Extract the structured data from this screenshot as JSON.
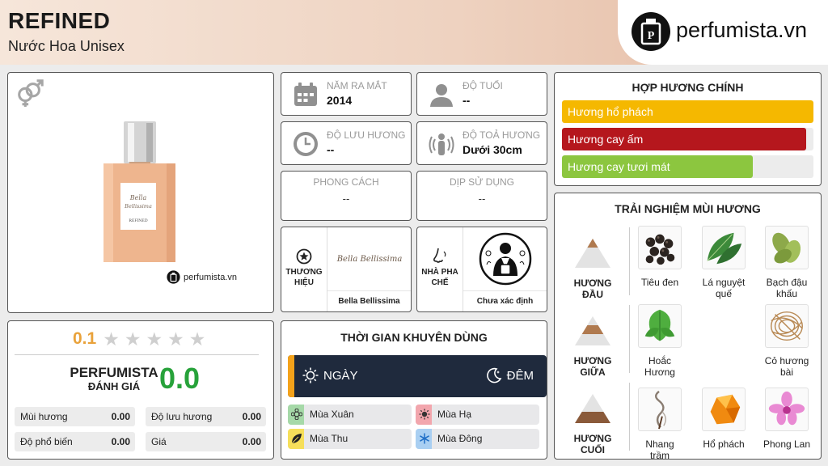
{
  "header": {
    "title": "REFINED",
    "subtitle": "Nước Hoa Unisex",
    "logo_text": "perfumista.vn"
  },
  "product": {
    "watermark": "perfumista.vn",
    "bottle_label_script": "Bella Bellissima",
    "bottle_label_name": "REFINED",
    "bottle_color": "#eeb58e"
  },
  "info": {
    "release": {
      "label": "NĂM RA MẮT",
      "value": "2014",
      "icon": "calendar-icon"
    },
    "age": {
      "label": "ĐỘ TUỔI",
      "value": "--",
      "icon": "person-icon"
    },
    "longevity": {
      "label": "ĐỘ LƯU HƯƠNG",
      "value": "--",
      "icon": "clock-icon"
    },
    "sillage": {
      "label": "ĐỘ TOẢ HƯƠNG",
      "value": "Dưới 30cm",
      "icon": "sillage-icon"
    },
    "style": {
      "label": "PHONG CÁCH",
      "value": "--"
    },
    "occasion": {
      "label": "DỊP SỬ DỤNG",
      "value": "--"
    }
  },
  "brand": {
    "label": "THƯƠNG HIỆU",
    "logo_script": "Bella Bellissima",
    "name": "Bella Bellissima"
  },
  "perfumer": {
    "label": "NHÀ PHA CHẾ",
    "name": "Chưa xác định"
  },
  "rating": {
    "score": "0.1",
    "stars": 0,
    "pf_label": "PERFUMISTA",
    "pf_sub": "ĐÁNH GIÁ",
    "pf_score": "0.0",
    "items": [
      {
        "label": "Mùi hương",
        "value": "0.00"
      },
      {
        "label": "Độ lưu hương",
        "value": "0.00"
      },
      {
        "label": "Độ phổ biến",
        "value": "0.00"
      },
      {
        "label": "Giá",
        "value": "0.00"
      }
    ]
  },
  "time": {
    "title": "THỜI GIAN KHUYÊN DÙNG",
    "day": "NGÀY",
    "night": "ĐÊM",
    "seasons": [
      {
        "label": "Mùa Xuân",
        "color": "#a6d9a8",
        "icon": "spring-icon"
      },
      {
        "label": "Mùa Hạ",
        "color": "#f2a6ad",
        "icon": "summer-icon"
      },
      {
        "label": "Mùa Thu",
        "color": "#f6df5a",
        "icon": "autumn-icon"
      },
      {
        "label": "Mùa Đông",
        "color": "#a9cff2",
        "icon": "winter-icon"
      }
    ]
  },
  "accords": {
    "title": "HỢP HƯƠNG CHÍNH",
    "items": [
      {
        "label": "Hương hổ phách",
        "level": 1.0,
        "color": "#f5b800"
      },
      {
        "label": "Hương cay ấm",
        "level": 0.97,
        "color": "#b5171d"
      },
      {
        "label": "Hương cay tươi mát",
        "level": 0.76,
        "color": "#8cc63f"
      }
    ]
  },
  "notes": {
    "title": "TRẢI NGHIỆM MÙI HƯƠNG",
    "top": {
      "label": "HƯƠNG ĐẦU",
      "items": [
        "Tiêu đen",
        "Lá nguyệt quế",
        "Bạch đậu khấu"
      ]
    },
    "middle": {
      "label": "HƯƠNG GIỮA",
      "items": [
        "Hoắc Hương",
        "Cỏ hương bài"
      ]
    },
    "base": {
      "label": "HƯƠNG CUỐI",
      "items": [
        "Nhang trầm",
        "Hổ phách",
        "Phong Lan"
      ]
    }
  }
}
